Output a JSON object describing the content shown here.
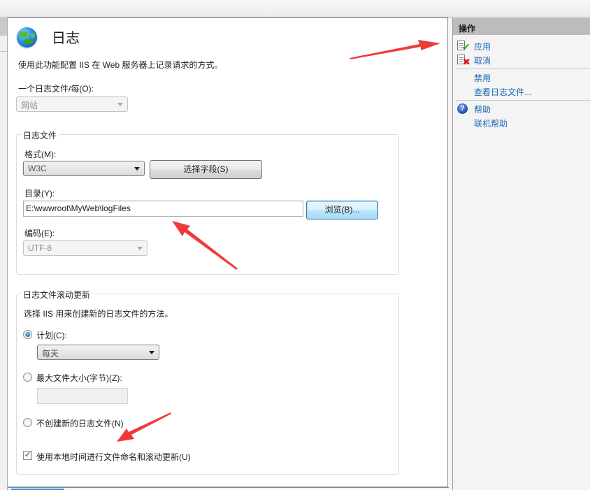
{
  "header": {
    "title": "日志",
    "description": "使用此功能配置 IIS 在 Web 服务器上记录请求的方式。",
    "icon": "globe-icon"
  },
  "one_log_per": {
    "label": "一个日志文件/每(O):",
    "value": "网站",
    "disabled": true
  },
  "log_file": {
    "group_title": "日志文件",
    "format_label": "格式(M):",
    "format_value": "W3C",
    "select_fields_button": "选择字段(S)",
    "directory_label": "目录(Y):",
    "directory_value": "E:\\wwwroot\\MyWeb\\logFiles",
    "browse_button": "浏览(B)...",
    "encoding_label": "编码(E):",
    "encoding_value": "UTF-8",
    "encoding_disabled": true
  },
  "rollover": {
    "group_title": "日志文件滚动更新",
    "description": "选择 IIS 用来创建新的日志文件的方法。",
    "schedule_label": "计划(C):",
    "schedule_checked": true,
    "schedule_value": "每天",
    "max_size_label": "最大文件大小(字节)(Z):",
    "max_size_checked": false,
    "max_size_value": "",
    "no_new_label": "不创建新的日志文件(N)",
    "no_new_checked": false,
    "local_time_label": "使用本地时间进行文件命名和滚动更新(U)",
    "local_time_checked": true,
    "checkmark": "✓"
  },
  "actions": {
    "header": "操作",
    "items": [
      {
        "label": "应用",
        "icon": "apply-icon"
      },
      {
        "label": "取消",
        "icon": "cancel-icon"
      },
      {
        "label": "禁用",
        "icon": ""
      },
      {
        "label": "查看日志文件...",
        "icon": ""
      },
      {
        "label": "帮助",
        "icon": "help-icon"
      },
      {
        "label": "联机帮助",
        "icon": ""
      }
    ],
    "help_glyph": "?",
    "check_glyph": "✔",
    "x_glyph": "✖"
  },
  "annotations": {
    "arrow_color": "#f03a3a"
  }
}
